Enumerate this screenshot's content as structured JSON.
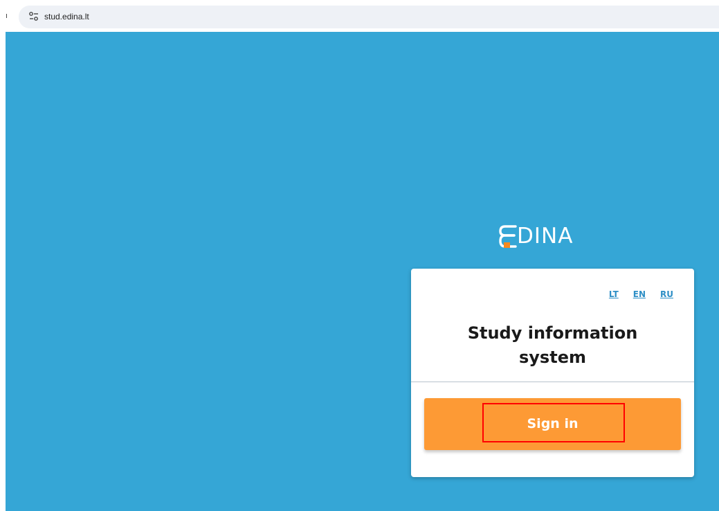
{
  "browser": {
    "url": "stud.edina.lt",
    "edge_glyph": "ı"
  },
  "logo": {
    "text": "DINA"
  },
  "card": {
    "languages": [
      "LT",
      "EN",
      "RU"
    ],
    "title_line1": "Study information",
    "title_line2": "system",
    "signin_label": "Sign in"
  },
  "colors": {
    "page_background": "#35a6d6",
    "button": "#fd9a35",
    "logo_accent": "#f6891f",
    "link": "#2e8fc6",
    "highlight": "#ff0000"
  },
  "icons": {
    "site_info": "tune-icon",
    "logo_mark": "edina-e-icon"
  }
}
